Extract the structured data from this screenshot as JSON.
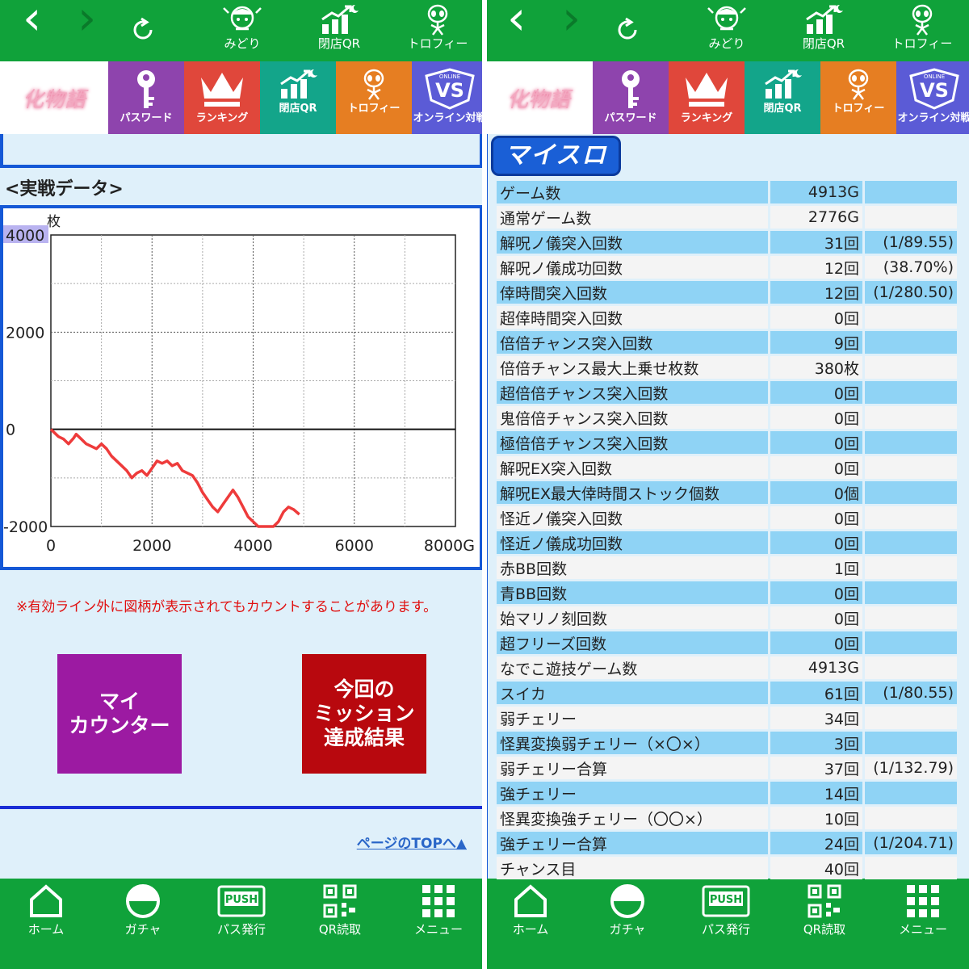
{
  "topbar": {
    "back_icon": "chevron-left-icon",
    "forward_icon": "chevron-right-icon",
    "reload_icon": "reload-icon",
    "items": [
      {
        "label": "みどり",
        "icon": "character-icon"
      },
      {
        "label": "閉店QR",
        "icon": "chart-up-icon"
      },
      {
        "label": "トロフィー",
        "icon": "alien-icon"
      }
    ]
  },
  "menubar": {
    "logo_text": "化物語",
    "items": [
      {
        "label": "パスワード",
        "icon": "key-icon",
        "color": "#8e44ad"
      },
      {
        "label": "ランキング",
        "icon": "crown-icon",
        "color": "#e0473b"
      },
      {
        "label": "閉店QR",
        "icon": "chart-up-icon",
        "color": "#13a58a"
      },
      {
        "label": "トロフィー",
        "icon": "alien-icon",
        "color": "#e67e22"
      },
      {
        "label": "オンライン対戦",
        "icon": "vs-icon",
        "color": "#5b5bd6"
      }
    ]
  },
  "left": {
    "section_title": "<実戦データ>",
    "note": "※有効ライン外に図柄が表示されてもカウントすることがあります。",
    "button_counter": "マイ\nカウンター",
    "button_mission": "今回の\nミッション\n達成結果",
    "page_top": "ページのTOPへ▲"
  },
  "chart_data": {
    "type": "line",
    "ylabel": "枚",
    "xlim": [
      0,
      8000
    ],
    "ylim": [
      -2000,
      4000
    ],
    "x_ticks": [
      "0",
      "2000",
      "4000",
      "6000",
      "8000G"
    ],
    "y_ticks": [
      "4000",
      "2000",
      "0",
      "-2000"
    ],
    "grid": true,
    "x": [
      0,
      150,
      250,
      350,
      450,
      500,
      600,
      700,
      800,
      900,
      1000,
      1100,
      1200,
      1300,
      1400,
      1500,
      1600,
      1700,
      1800,
      1900,
      2000,
      2100,
      2200,
      2300,
      2400,
      2500,
      2600,
      2700,
      2800,
      2900,
      3000,
      3100,
      3200,
      3300,
      3400,
      3500,
      3600,
      3700,
      3800,
      3900,
      4000,
      4100,
      4200,
      4300,
      4400,
      4500,
      4600,
      4700,
      4800,
      4913
    ],
    "y": [
      0,
      -150,
      -200,
      -300,
      -180,
      -100,
      -200,
      -300,
      -350,
      -400,
      -300,
      -400,
      -550,
      -650,
      -750,
      -850,
      -1000,
      -900,
      -850,
      -950,
      -800,
      -650,
      -700,
      -650,
      -750,
      -700,
      -850,
      -900,
      -950,
      -1100,
      -1300,
      -1450,
      -1600,
      -1700,
      -1550,
      -1400,
      -1250,
      -1400,
      -1600,
      -1800,
      -1900,
      -2000,
      -2000,
      -2000,
      -2000,
      -1900,
      -1700,
      -1600,
      -1650,
      -1750
    ]
  },
  "right": {
    "header": "マイスロ",
    "rows": [
      {
        "name": "ゲーム数",
        "value": "4913G",
        "ratio": ""
      },
      {
        "name": "通常ゲーム数",
        "value": "2776G",
        "ratio": ""
      },
      {
        "name": "解呪ノ儀突入回数",
        "value": "31回",
        "ratio": "(1/89.55)"
      },
      {
        "name": "解呪ノ儀成功回数",
        "value": "12回",
        "ratio": "(38.70%)"
      },
      {
        "name": "倖時間突入回数",
        "value": "12回",
        "ratio": "(1/280.50)"
      },
      {
        "name": "超倖時間突入回数",
        "value": "0回",
        "ratio": ""
      },
      {
        "name": "倍倍チャンス突入回数",
        "value": "9回",
        "ratio": ""
      },
      {
        "name": "倍倍チャンス最大上乗せ枚数",
        "value": "380枚",
        "ratio": ""
      },
      {
        "name": "超倍倍チャンス突入回数",
        "value": "0回",
        "ratio": ""
      },
      {
        "name": "鬼倍倍チャンス突入回数",
        "value": "0回",
        "ratio": ""
      },
      {
        "name": "極倍倍チャンス突入回数",
        "value": "0回",
        "ratio": ""
      },
      {
        "name": "解呪EX突入回数",
        "value": "0回",
        "ratio": ""
      },
      {
        "name": "解呪EX最大倖時間ストック個数",
        "value": "0個",
        "ratio": ""
      },
      {
        "name": "怪近ノ儀突入回数",
        "value": "0回",
        "ratio": ""
      },
      {
        "name": "怪近ノ儀成功回数",
        "value": "0回",
        "ratio": ""
      },
      {
        "name": "赤BB回数",
        "value": "1回",
        "ratio": ""
      },
      {
        "name": "青BB回数",
        "value": "0回",
        "ratio": ""
      },
      {
        "name": "始マリノ刻回数",
        "value": "0回",
        "ratio": ""
      },
      {
        "name": "超フリーズ回数",
        "value": "0回",
        "ratio": ""
      },
      {
        "name": "なでこ遊技ゲーム数",
        "value": "4913G",
        "ratio": ""
      },
      {
        "name": "スイカ",
        "value": "61回",
        "ratio": "(1/80.55)"
      },
      {
        "name": "弱チェリー",
        "value": "34回",
        "ratio": ""
      },
      {
        "name": "怪異変換弱チェリー（×〇×）",
        "value": "3回",
        "ratio": ""
      },
      {
        "name": "弱チェリー合算",
        "value": "37回",
        "ratio": "(1/132.79)"
      },
      {
        "name": "強チェリー",
        "value": "14回",
        "ratio": ""
      },
      {
        "name": "怪異変換強チェリー（〇〇×）",
        "value": "10回",
        "ratio": ""
      },
      {
        "name": "強チェリー合算",
        "value": "24回",
        "ratio": "(1/204.71)"
      },
      {
        "name": "チャンス目",
        "value": "40回",
        "ratio": ""
      }
    ]
  },
  "bottombar": {
    "items": [
      {
        "label": "ホーム",
        "icon": "home-icon"
      },
      {
        "label": "ガチャ",
        "icon": "gacha-icon"
      },
      {
        "label": "パス発行",
        "icon": "push-icon"
      },
      {
        "label": "QR読取",
        "icon": "qr-icon"
      },
      {
        "label": "メニュー",
        "icon": "grid-menu-icon"
      }
    ]
  }
}
